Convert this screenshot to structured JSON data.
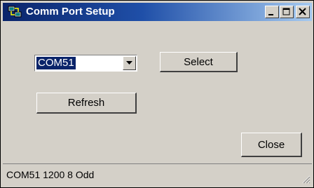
{
  "window": {
    "title": "Comm Port Setup",
    "icon": "network-computer-icon",
    "controls": {
      "minimize_icon": "minimize-icon",
      "maximize_icon": "maximize-icon",
      "close_icon": "close-icon"
    }
  },
  "port_select": {
    "selected_value": "COM51",
    "dropdown_icon": "chevron-down-icon"
  },
  "buttons": {
    "select_label": "Select",
    "refresh_label": "Refresh",
    "close_label": "Close"
  },
  "statusbar": {
    "text": "COM51 1200 8 Odd",
    "grip_icon": "resize-grip-icon"
  },
  "colors": {
    "titlebar_start": "#0a246a",
    "titlebar_end": "#a6caf0",
    "face": "#d4d0c8",
    "selection": "#0a246a"
  }
}
